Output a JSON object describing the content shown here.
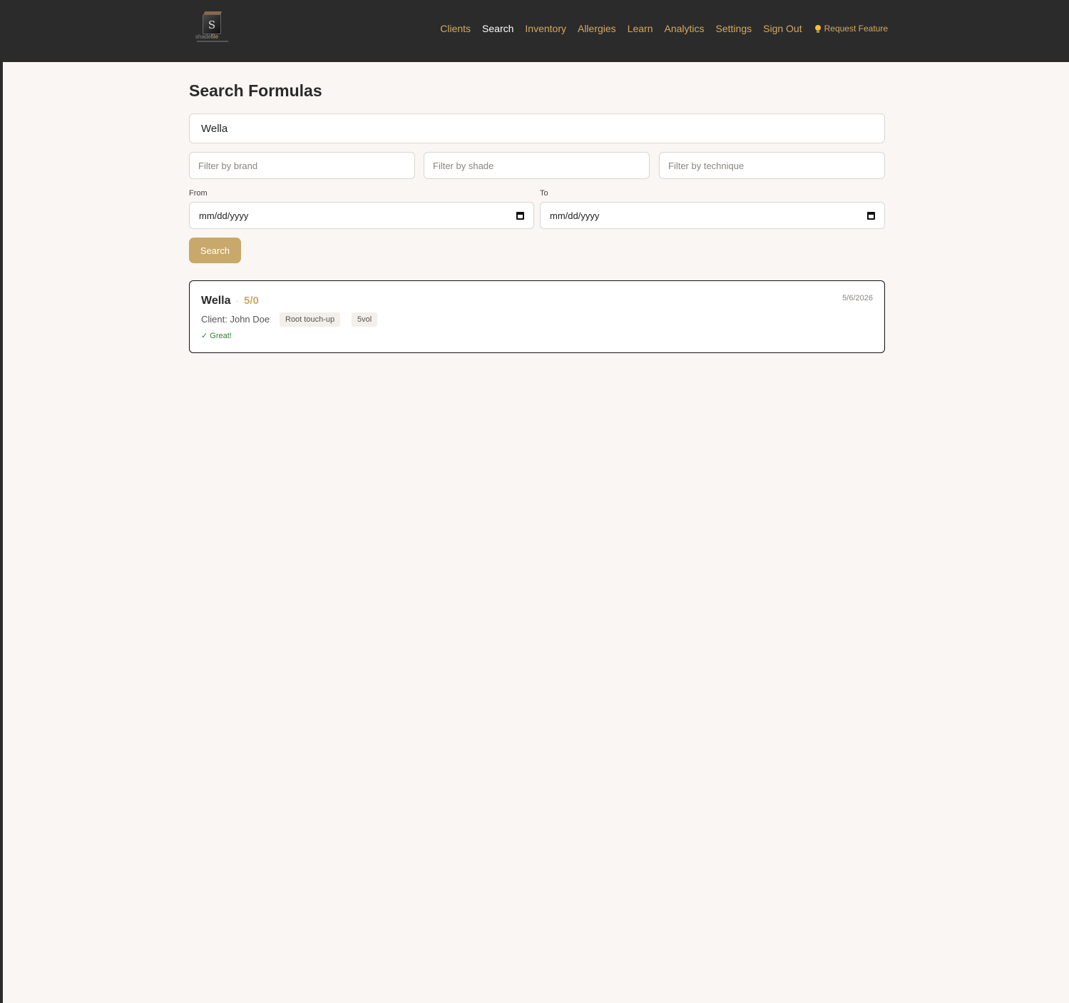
{
  "logo": {
    "mark": "S",
    "name_part1": "shade",
    "name_part2": "file"
  },
  "nav": {
    "items": [
      {
        "label": "Clients"
      },
      {
        "label": "Search"
      },
      {
        "label": "Inventory"
      },
      {
        "label": "Allergies"
      },
      {
        "label": "Learn"
      },
      {
        "label": "Analytics"
      },
      {
        "label": "Settings"
      },
      {
        "label": "Sign Out"
      }
    ],
    "active": "Search",
    "request_feature": {
      "icon": "lightbulb-icon",
      "label": "Request Feature"
    }
  },
  "page": {
    "title": "Search Formulas"
  },
  "search": {
    "value": "Wella"
  },
  "filters": {
    "brand_placeholder": "Filter by brand",
    "shade_placeholder": "Filter by shade",
    "technique_placeholder": "Filter by technique"
  },
  "dates": {
    "from_label": "From",
    "to_label": "To",
    "from_value": "mm/dd/yyyy",
    "to_value": "mm/dd/yyyy"
  },
  "search_button": "Search",
  "results": [
    {
      "brand": "Wella",
      "separator": "·",
      "shade": "5/0",
      "date": "5/6/2026",
      "client": "Client: John Doe",
      "tags": [
        "Root touch-up",
        "5vol"
      ],
      "note": "✓ Great!"
    }
  ],
  "colors": {
    "accent": "#c9a86c",
    "nav_text": "#d4a95f",
    "header_bg": "#2b2b2b",
    "page_bg": "#f9f6f3",
    "success": "#2e7d32"
  }
}
